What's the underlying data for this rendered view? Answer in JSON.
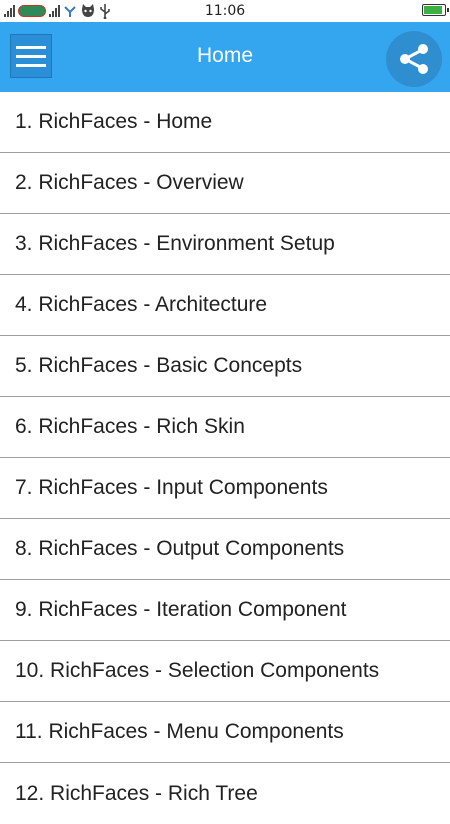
{
  "status_bar": {
    "time": "11:06",
    "icons": [
      "signal-icon",
      "carrier-logo-icon",
      "signal-icon",
      "bluetooth-icon",
      "cat-icon",
      "usb-icon",
      "battery-charging-icon"
    ]
  },
  "app_bar": {
    "title": "Home",
    "menu_icon": "hamburger-menu-icon",
    "share_icon": "share-icon",
    "color": "#34a6f0"
  },
  "items": [
    {
      "label": "1. RichFaces - Home"
    },
    {
      "label": "2. RichFaces - Overview"
    },
    {
      "label": "3. RichFaces - Environment Setup"
    },
    {
      "label": "4. RichFaces - Architecture"
    },
    {
      "label": "5. RichFaces - Basic Concepts"
    },
    {
      "label": "6. RichFaces - Rich Skin"
    },
    {
      "label": "7. RichFaces - Input Components"
    },
    {
      "label": "8. RichFaces - Output Components"
    },
    {
      "label": "9. RichFaces - Iteration Component"
    },
    {
      "label": "10. RichFaces - Selection Components"
    },
    {
      "label": "11. RichFaces - Menu Components"
    },
    {
      "label": "12. RichFaces - Rich Tree"
    }
  ]
}
